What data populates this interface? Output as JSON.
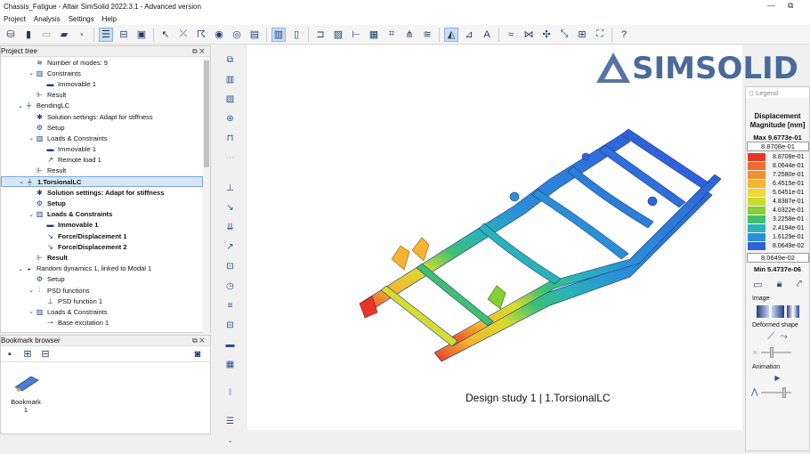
{
  "window": {
    "title": "Chassis_Fatigue - Altair SimSolid 2022.3.1 - Advanced version"
  },
  "menu": [
    "Project",
    "Analysis",
    "Settings",
    "Help"
  ],
  "project_tree": {
    "title": "Project tree",
    "rows": [
      {
        "label": "Number of modes: 9",
        "indent": 2,
        "icon": "modes-icon",
        "arrow": "",
        "bold": false
      },
      {
        "label": "Constraints",
        "indent": 2,
        "icon": "constraints-icon",
        "arrow": "v",
        "bold": false
      },
      {
        "label": "Immovable 1",
        "indent": 3,
        "icon": "immovable-icon",
        "arrow": "",
        "bold": false
      },
      {
        "label": "Result",
        "indent": 2,
        "icon": "result-icon",
        "arrow": "",
        "bold": false
      },
      {
        "label": "BendingLC",
        "indent": 1,
        "icon": "load-case-icon",
        "arrow": "v",
        "bold": false
      },
      {
        "label": "Solution settings: Adapt for stiffness",
        "indent": 2,
        "icon": "settings-icon",
        "arrow": "",
        "bold": false
      },
      {
        "label": "Setup",
        "indent": 2,
        "icon": "setup-icon",
        "arrow": "",
        "bold": false
      },
      {
        "label": "Loads & Constraints",
        "indent": 2,
        "icon": "constraints-icon",
        "arrow": "v",
        "bold": false
      },
      {
        "label": "Immovable 1",
        "indent": 3,
        "icon": "immovable-icon",
        "arrow": "",
        "bold": false
      },
      {
        "label": "Remote load 1",
        "indent": 3,
        "icon": "remote-load-icon",
        "arrow": "",
        "bold": false
      },
      {
        "label": "Result",
        "indent": 2,
        "icon": "result-icon",
        "arrow": "",
        "bold": false
      },
      {
        "label": "1.TorsionalLC",
        "indent": 1,
        "icon": "load-case-icon",
        "arrow": "v",
        "bold": true,
        "selected": true
      },
      {
        "label": "Solution settings: Adapt for stiffness",
        "indent": 2,
        "icon": "settings-icon",
        "arrow": "",
        "bold": true
      },
      {
        "label": "Setup",
        "indent": 2,
        "icon": "setup-icon",
        "arrow": "",
        "bold": true
      },
      {
        "label": "Loads & Constraints",
        "indent": 2,
        "icon": "constraints-icon",
        "arrow": "v",
        "bold": true
      },
      {
        "label": "Immovable 1",
        "indent": 3,
        "icon": "immovable-icon",
        "arrow": "",
        "bold": true
      },
      {
        "label": "Force/Displacement 1",
        "indent": 3,
        "icon": "force-icon",
        "arrow": "",
        "bold": true
      },
      {
        "label": "Force/Displacement 2",
        "indent": 3,
        "icon": "force-icon",
        "arrow": "",
        "bold": true
      },
      {
        "label": "Result",
        "indent": 2,
        "icon": "result-icon",
        "arrow": "",
        "bold": true
      },
      {
        "label": "Random dynamics 1, linked to Modal 1",
        "indent": 1,
        "icon": "dynamics-icon",
        "arrow": "v",
        "bold": false
      },
      {
        "label": "Setup",
        "indent": 2,
        "icon": "setup-icon",
        "arrow": "",
        "bold": false
      },
      {
        "label": "PSD functions",
        "indent": 2,
        "icon": "psd-icon",
        "arrow": "v",
        "bold": false
      },
      {
        "label": "PSD function  1",
        "indent": 3,
        "icon": "psd-function-icon",
        "arrow": "",
        "bold": false
      },
      {
        "label": "Loads & Constraints",
        "indent": 2,
        "icon": "constraints-icon",
        "arrow": "v",
        "bold": false
      },
      {
        "label": "Base excitation 1",
        "indent": 3,
        "icon": "excitation-icon",
        "arrow": "",
        "bold": false
      }
    ]
  },
  "bookmark_browser": {
    "title": "Bookmark browser",
    "items": [
      {
        "label": "Bookmark 1"
      }
    ]
  },
  "viewport": {
    "logo_text": "SIMSOLID",
    "caption": "Design study 1 | 1.TorsionalLC"
  },
  "legend": {
    "title": "Legend",
    "quantity": "Displacement",
    "component": "Magnitude [mm]",
    "max_label": "Max  9.6773e-01",
    "upper_box": "8.8708e-01",
    "values": [
      "8.8708e-01",
      "8.0644e-01",
      "7.2580e-01",
      "6.4515e-01",
      "5.6451e-01",
      "4.8387e-01",
      "4.0322e-01",
      "3.2258e-01",
      "2.4194e-01",
      "1.6129e-01",
      "8.0649e-02"
    ],
    "colors": [
      "#e8352a",
      "#ef6a2c",
      "#f38f2f",
      "#f5b531",
      "#f2d631",
      "#c8dc2e",
      "#86cf37",
      "#3fbf6f",
      "#29b3b8",
      "#2b8fd8",
      "#2f62d9"
    ],
    "lower_box": "8.0649e-02",
    "min_label": "Min  5.4737e-06",
    "image_label": "Image",
    "deformed_label": "Deformed shape",
    "animation_label": "Animation"
  }
}
